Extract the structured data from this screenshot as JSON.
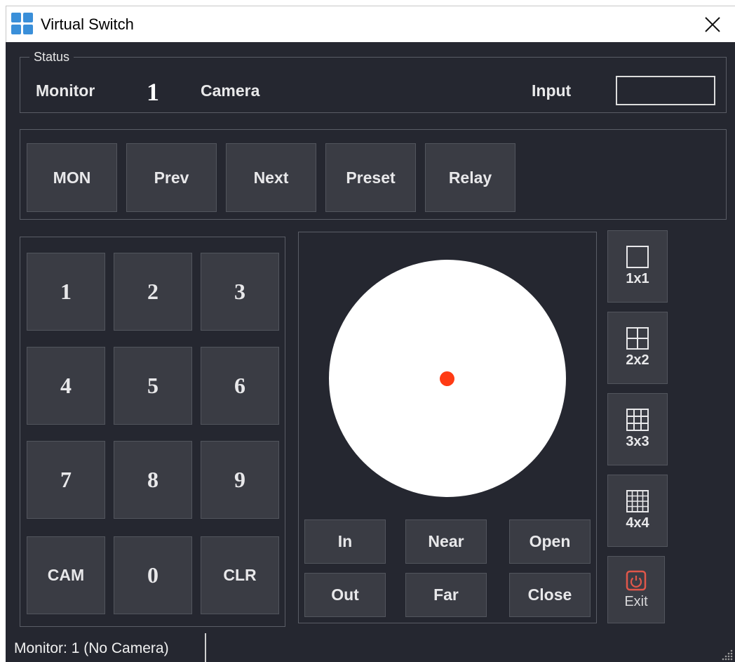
{
  "window": {
    "title": "Virtual Switch",
    "app_icon": "app-grid-icon",
    "close_icon": "close-icon"
  },
  "status": {
    "legend": "Status",
    "monitor_label": "Monitor",
    "monitor_value": "1",
    "camera_label": "Camera",
    "input_label": "Input",
    "input_value": ""
  },
  "toolbar": {
    "mon": "MON",
    "prev": "Prev",
    "next": "Next",
    "preset": "Preset",
    "relay": "Relay"
  },
  "keypad": {
    "k1": "1",
    "k2": "2",
    "k3": "3",
    "k4": "4",
    "k5": "5",
    "k6": "6",
    "k7": "7",
    "k8": "8",
    "k9": "9",
    "cam": "CAM",
    "k0": "0",
    "clr": "CLR"
  },
  "ptz": {
    "zoom_in": "In",
    "zoom_out": "Out",
    "focus_near": "Near",
    "focus_far": "Far",
    "iris_open": "Open",
    "iris_close": "Close"
  },
  "layouts": {
    "l1": "1x1",
    "l2": "2x2",
    "l3": "3x3",
    "l4": "4x4",
    "exit": "Exit"
  },
  "statusbar": {
    "text": "Monitor: 1 (No Camera)"
  },
  "colors": {
    "background": "#252730",
    "button": "#3a3c44",
    "joystick_dot": "#ff3b14",
    "exit_icon": "#e0574a",
    "app_icon": "#3a8fd9"
  }
}
